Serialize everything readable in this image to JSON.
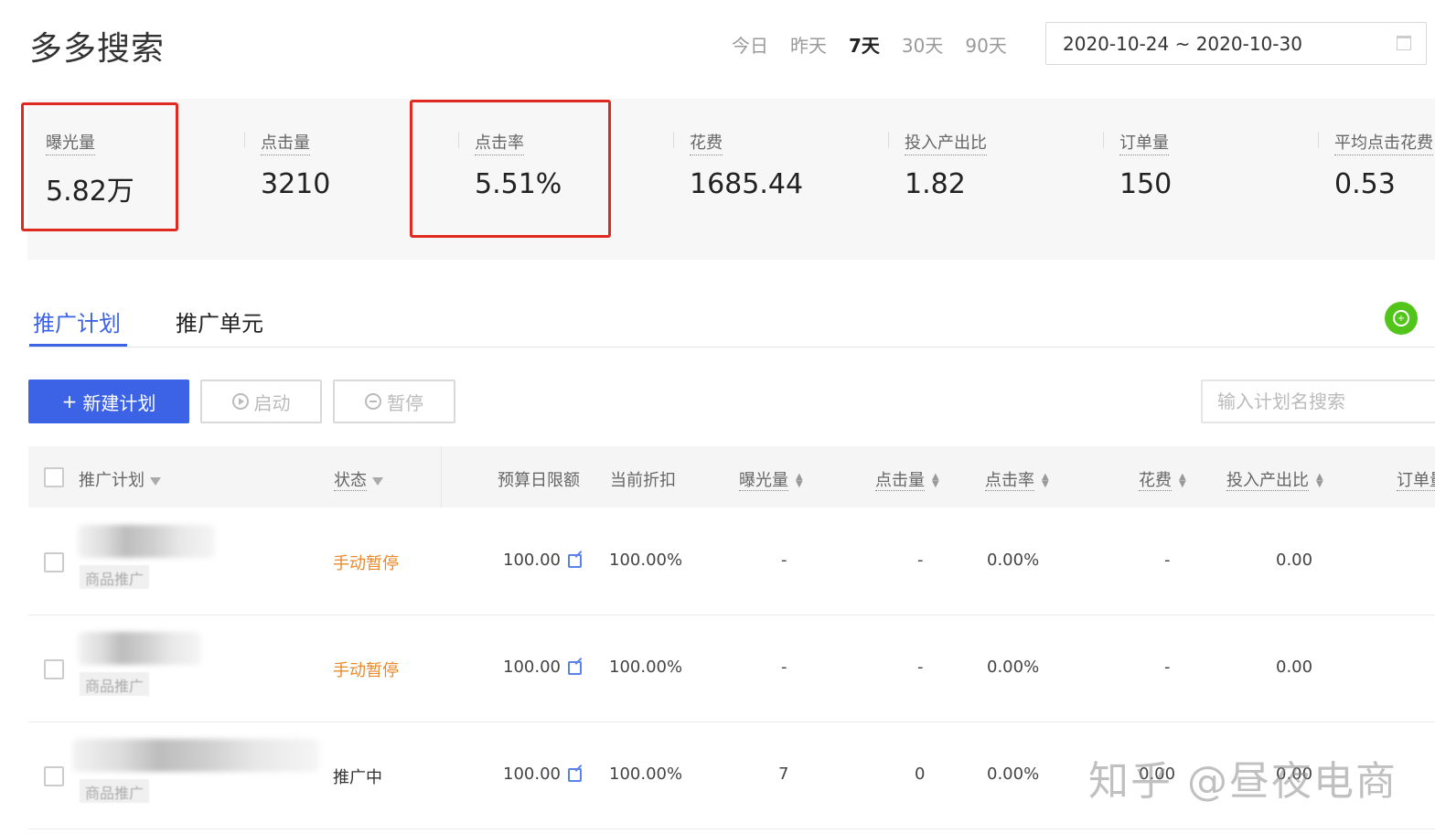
{
  "page_title": "多多搜索",
  "range_options": [
    {
      "label": "今日",
      "active": false
    },
    {
      "label": "昨天",
      "active": false
    },
    {
      "label": "7天",
      "active": true
    },
    {
      "label": "30天",
      "active": false
    },
    {
      "label": "90天",
      "active": false
    }
  ],
  "date_range": "2020-10-24 ~ 2020-10-30",
  "metrics": [
    {
      "label": "曝光量",
      "value": "5.82万",
      "highlighted": true
    },
    {
      "label": "点击量",
      "value": "3210",
      "highlighted": false
    },
    {
      "label": "点击率",
      "value": "5.51%",
      "highlighted": true
    },
    {
      "label": "花费",
      "value": "1685.44",
      "highlighted": false
    },
    {
      "label": "投入产出比",
      "value": "1.82",
      "highlighted": false
    },
    {
      "label": "订单量",
      "value": "150",
      "highlighted": false
    },
    {
      "label": "平均点击花费",
      "value": "0.53",
      "highlighted": false
    }
  ],
  "tabs": [
    {
      "label": "推广计划",
      "active": true
    },
    {
      "label": "推广单元",
      "active": false
    }
  ],
  "toolbar": {
    "new_plan": "新建计划",
    "start": "启动",
    "pause": "暂停",
    "search_placeholder": "输入计划名搜索"
  },
  "table": {
    "headers": {
      "plan": "推广计划",
      "status": "状态",
      "budget": "预算日限额",
      "discount": "当前折扣",
      "impressions": "曝光量",
      "clicks": "点击量",
      "ctr": "点击率",
      "cost": "花费",
      "roi": "投入产出比",
      "orders": "订单量"
    },
    "rows": [
      {
        "type": "商品推广",
        "status": "手动暂停",
        "budget": "100.00",
        "discount": "100.00%",
        "impressions": "-",
        "clicks": "-",
        "ctr": "0.00%",
        "cost": "-",
        "roi": "0.00"
      },
      {
        "type": "商品推广",
        "status": "手动暂停",
        "budget": "100.00",
        "discount": "100.00%",
        "impressions": "-",
        "clicks": "-",
        "ctr": "0.00%",
        "cost": "-",
        "roi": "0.00"
      },
      {
        "type": "商品推广",
        "status": "推广中",
        "budget": "100.00",
        "discount": "100.00%",
        "impressions": "7",
        "clicks": "0",
        "ctr": "0.00%",
        "cost": "0.00",
        "roi": "0.00"
      }
    ]
  },
  "watermark": "知乎 @昼夜电商",
  "colors": {
    "accent": "#3c63e6",
    "paused": "#e8892c",
    "highlight_box": "#e02a20",
    "green_button": "#52c41a"
  }
}
